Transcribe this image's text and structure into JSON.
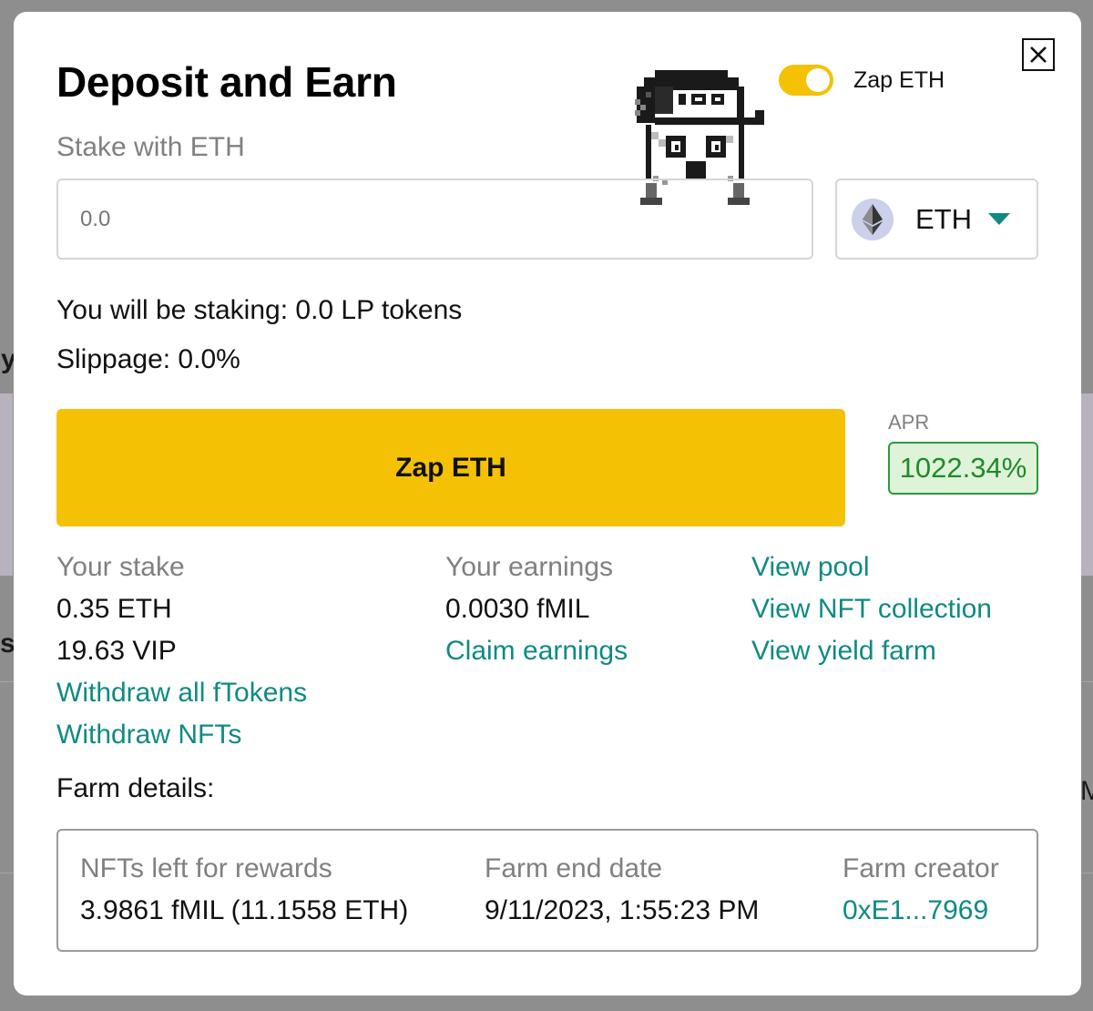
{
  "modal": {
    "title": "Deposit and Earn",
    "close_icon": "close-icon"
  },
  "toggle": {
    "label": "Zap ETH",
    "on": true,
    "color": "#f5c104"
  },
  "stake": {
    "label": "Stake with ETH",
    "input_placeholder": "0.0",
    "input_value": "",
    "token": "ETH",
    "token_icon": "ethereum-icon",
    "dropdown_icon": "caret-down-icon"
  },
  "summary": {
    "staking_line": "You will be staking: 0.0 LP tokens",
    "slippage_line": "Slippage: 0.0%"
  },
  "action": {
    "button_label": "Zap ETH",
    "button_color": "#f5c104"
  },
  "apr": {
    "label": "APR",
    "value": "1022.34%"
  },
  "your_stake": {
    "heading": "Your stake",
    "eth": "0.35 ETH",
    "vip": "19.63 VIP",
    "withdraw_ftokens": "Withdraw all fTokens",
    "withdraw_nfts": "Withdraw NFTs"
  },
  "your_earnings": {
    "heading": "Your earnings",
    "amount": "0.0030 fMIL",
    "claim": "Claim earnings"
  },
  "links": {
    "view_pool": "View pool",
    "view_nft_collection": "View NFT collection",
    "view_yield_farm": "View yield farm"
  },
  "farm": {
    "title": "Farm details:",
    "nfts_left_label": "NFTs left for rewards",
    "nfts_left_value": "3.9861 fMIL (11.1558 ETH)",
    "end_date_label": "Farm end date",
    "end_date_value": "9/11/2023, 1:55:23 PM",
    "creator_label": "Farm creator",
    "creator_value": "0xE1...7969"
  },
  "colors": {
    "link": "#0f8a83",
    "accent": "#f5c104",
    "apr_green": "#1f8a2c"
  }
}
